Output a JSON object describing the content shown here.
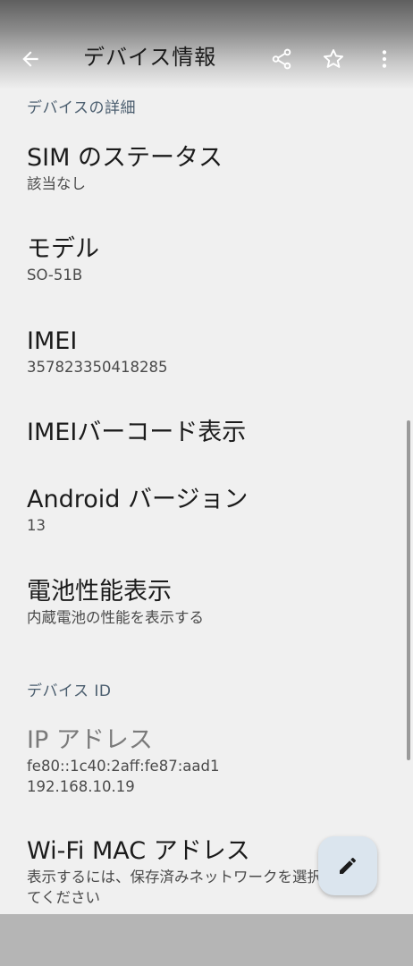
{
  "appbar": {
    "title": "デバイス情報",
    "back_icon": "arrow-left-icon",
    "share_icon": "share-icon",
    "star_icon": "star-outline-icon",
    "more_icon": "more-vert-icon"
  },
  "sections": {
    "details_header": "デバイスの詳細",
    "id_header": "デバイス ID"
  },
  "items": [
    {
      "title": "SIM のステータス",
      "summary": "該当なし"
    },
    {
      "title": "モデル",
      "summary": "SO-51B"
    },
    {
      "title": "IMEI",
      "summary": "357823350418285"
    },
    {
      "title": "IMEIバーコード表示",
      "summary": ""
    },
    {
      "title": "Android バージョン",
      "summary": "13"
    },
    {
      "title": "電池性能表示",
      "summary": "内蔵電池の性能を表示する"
    },
    {
      "title": "IP アドレス",
      "summary": "fe80::1c40:2aff:fe87:aad1",
      "summary2": "192.168.10.19"
    },
    {
      "title": "Wi-Fi MAC アドレス",
      "summary": "表示するには、保存済みネットワークを選択し",
      "summary2": "てください"
    }
  ],
  "fab": {
    "icon": "pencil-icon"
  },
  "colors": {
    "background": "#f0f0f0",
    "fab": "#dbe5ee",
    "section_header": "#4a5d6e"
  }
}
